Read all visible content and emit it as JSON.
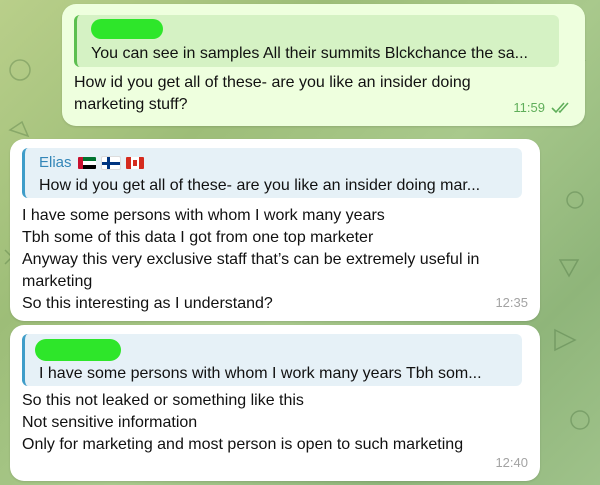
{
  "messages": [
    {
      "quote_text": "You can see in samples  All their summits  Blckchance the sa...",
      "lines": [
        "How id you get all of these- are you like an insider doing",
        "marketing stuff?"
      ],
      "time": "11:59"
    },
    {
      "sender": "Elias",
      "sender_flags": [
        "flag-uae-icon",
        "flag-finland-icon",
        "flag-canada-icon"
      ],
      "quote_text": "How id you get all of these- are you like an insider doing mar...",
      "lines": [
        "I have some persons with whom I work many years",
        "Tbh some of this data I got from one top marketer",
        "Anyway this very exclusive staff that’s can be extremely useful in",
        "marketing",
        "So this interesting as I understand?"
      ],
      "time": "12:35"
    },
    {
      "quote_text": "I have some persons with whom I work many years  Tbh som...",
      "lines": [
        "So this not leaked or something like this",
        "Not sensitive information",
        "Only for marketing and most person is open to such marketing"
      ],
      "time": "12:40"
    }
  ],
  "colors": {
    "outgoing_bubble": "#eeffde",
    "incoming_bubble": "#ffffff",
    "sender_name": "#3386b8",
    "redaction": "#2ee62a"
  }
}
